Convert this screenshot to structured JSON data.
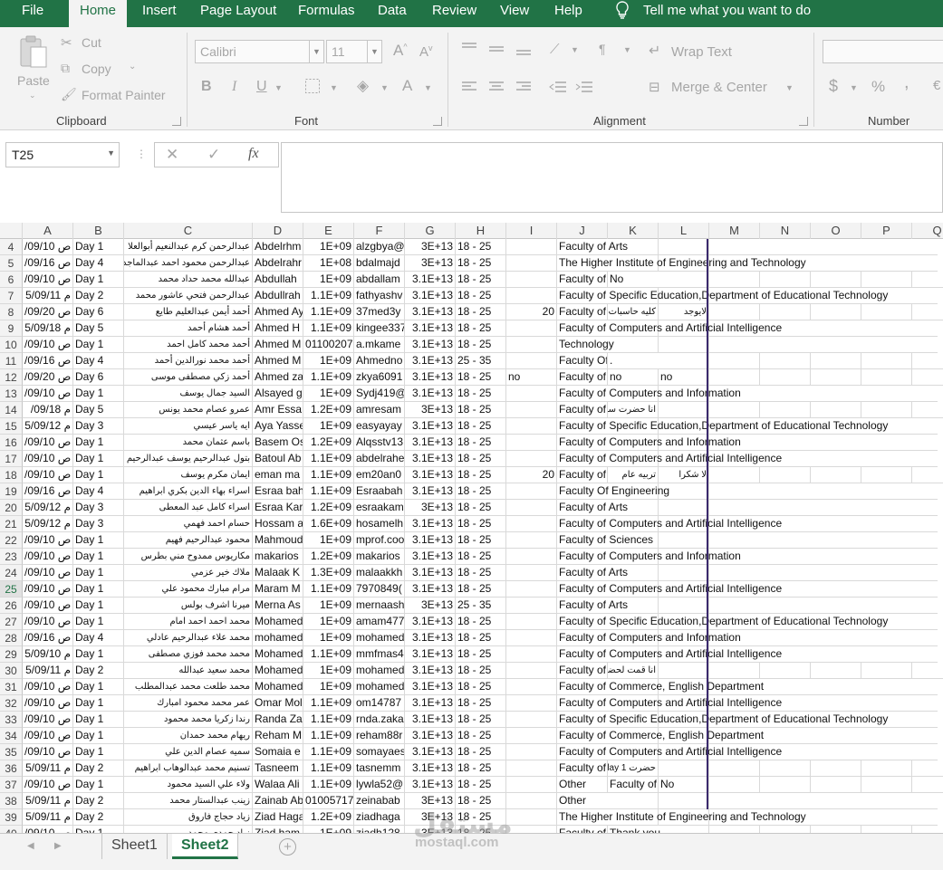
{
  "menu": {
    "file": "File",
    "home": "Home",
    "insert": "Insert",
    "page_layout": "Page Layout",
    "formulas": "Formulas",
    "data": "Data",
    "review": "Review",
    "view": "View",
    "help": "Help",
    "tell_me": "Tell me what you want to do"
  },
  "ribbon": {
    "clipboard": {
      "paste": "Paste",
      "cut": "Cut",
      "copy": "Copy",
      "format_painter": "Format Painter",
      "label": "Clipboard"
    },
    "font": {
      "name": "Calibri",
      "size": "11",
      "label": "Font",
      "bold": "B",
      "italic": "I",
      "underline": "U",
      "grow": "A",
      "shrink": "A",
      "font_color": "A"
    },
    "alignment": {
      "wrap_text": "Wrap Text",
      "merge_center": "Merge & Center",
      "label": "Alignment"
    },
    "number": {
      "label": "Number",
      "currency": "$",
      "percent": "%",
      "comma": ","
    }
  },
  "formula_bar": {
    "name_box": "T25",
    "cancel": "✕",
    "enter": "✓",
    "fx": "fx",
    "value": ""
  },
  "columns": [
    "A",
    "B",
    "C",
    "D",
    "E",
    "F",
    "G",
    "H",
    "I",
    "J",
    "K",
    "L",
    "M",
    "N",
    "O",
    "P",
    "Q"
  ],
  "rows": [
    {
      "n": "4",
      "a": "/09/10 ص",
      "b": "Day 1",
      "c": "عبدالرحمن كرم عبدالنعيم أبوالعلا",
      "d": "Abdelrhm",
      "e": "1E+09",
      "f": "alzgbya@",
      "g": "3E+13",
      "h": "18 - 25",
      "i": "",
      "j": "Faculty of Arts",
      "k": "",
      "l": ""
    },
    {
      "n": "5",
      "a": "/09/16 ص",
      "b": "Day 4",
      "c": "عبدالرحمن محمود احمد عبدالماجد",
      "d": "Abdelrahr",
      "e": "1E+08",
      "f": "bdalmajd",
      "g": "3E+13",
      "h": "18 - 25",
      "i": "",
      "j": "The Higher Institute of Engineering and Technology",
      "k": "",
      "l": ""
    },
    {
      "n": "6",
      "a": "/09/10 ص",
      "b": "Day 1",
      "c": "عبدالله محمد حداد محمد",
      "d": "Abdullah",
      "e": "1E+09",
      "f": "abdallam",
      "g": "3.1E+13",
      "h": "18 - 25",
      "i": "",
      "j": "Faculty of Compute",
      "k": "No",
      "l": ""
    },
    {
      "n": "7",
      "a": "5/09/11 م",
      "b": "Day 2",
      "c": "عبدالرحمن فتحي عاشور محمد",
      "d": "Abdullrah",
      "e": "1.1E+09",
      "f": "fathyashv",
      "g": "3.1E+13",
      "h": "18 - 25",
      "i": "",
      "j": "Faculty of Specific Education,Department of Educational Technology",
      "k": "",
      "l": ""
    },
    {
      "n": "8",
      "a": "/09/20 ص",
      "b": "Day 6",
      "c": "أحمد أيمن عبدالعليم طايع",
      "d": "Ahmed Ay",
      "e": "1.1E+09",
      "f": "37med3y",
      "g": "3.1E+13",
      "h": "18 - 25",
      "i": "20",
      "j": "Faculty of",
      "k": "كليه حاسبات و",
      "l": "لايوجد"
    },
    {
      "n": "9",
      "a": "5/09/18 م",
      "b": "Day 5",
      "c": "أحمد هشام أحمد",
      "d": "Ahmed H",
      "e": "1.1E+09",
      "f": "kingee337",
      "g": "3.1E+13",
      "h": "18 - 25",
      "i": "",
      "j": "Faculty of Computers and Artificial Intelligence",
      "k": "",
      "l": ""
    },
    {
      "n": "10",
      "a": "/09/10 ص",
      "b": "Day 1",
      "c": "أحمد محمد كامل احمد",
      "d": "Ahmed M",
      "e": "01100207",
      "f": "a.mkame",
      "g": "3.1E+13",
      "h": "18 - 25",
      "i": "",
      "j": "Technology",
      "k": "",
      "l": ""
    },
    {
      "n": "11",
      "a": "/09/16 ص",
      "b": "Day 4",
      "c": "أحمد محمد نورالدين أحمد",
      "d": "Ahmed M",
      "e": "1E+09",
      "f": "Ahmedno",
      "g": "3.1E+13",
      "h": "25 - 35",
      "i": "",
      "j": "Faculty Of Engineeri",
      "k": ".",
      "l": ""
    },
    {
      "n": "12",
      "a": "/09/20 ص",
      "b": "Day 6",
      "c": "أحمد زكي مصطفى موسى",
      "d": "Ahmed za",
      "e": "1.1E+09",
      "f": "zkya6091",
      "g": "3.1E+13",
      "h": "18 - 25",
      "i": "no",
      "j": "Faculty of",
      "k": "no",
      "l": "no"
    },
    {
      "n": "13",
      "a": "/09/10 ص",
      "b": "Day 1",
      "c": "السيد جمال يوسف",
      "d": "Alsayed g",
      "e": "1E+09",
      "f": "Sydj419@",
      "g": "3.1E+13",
      "h": "18 - 25",
      "i": "",
      "j": "Faculty of Computers and Information",
      "k": "",
      "l": ""
    },
    {
      "n": "14",
      "a": "/09/18 م",
      "b": "Day 5",
      "c": "عمرو عصام محمد يونس",
      "d": "Amr Essa",
      "e": "1.2E+09",
      "f": "amresam",
      "g": "3E+13",
      "h": "18 - 25",
      "i": "",
      "j": "Faculty of Computer",
      "k": "انا حضرت سيشن",
      "l": ""
    },
    {
      "n": "15",
      "a": "5/09/12 م",
      "b": "Day 3",
      "c": "ايه ياسر عيسي",
      "d": "Aya Yasse",
      "e": "1E+09",
      "f": "easyayay",
      "g": "3.1E+13",
      "h": "18 - 25",
      "i": "",
      "j": "Faculty of Specific Education,Department of Educational Technology",
      "k": "",
      "l": ""
    },
    {
      "n": "16",
      "a": "/09/10 ص",
      "b": "Day 1",
      "c": "باسم عثمان محمد",
      "d": "Basem Os",
      "e": "1.2E+09",
      "f": "Alqsstv13",
      "g": "3.1E+13",
      "h": "18 - 25",
      "i": "",
      "j": "Faculty of Computers and Information",
      "k": "",
      "l": ""
    },
    {
      "n": "17",
      "a": "/09/10 ص",
      "b": "Day 1",
      "c": "بتول عبدالرحيم يوسف عبدالرحيم",
      "d": "Batoul Ab",
      "e": "1.1E+09",
      "f": "abdelrahe",
      "g": "3.1E+13",
      "h": "18 - 25",
      "i": "",
      "j": "Faculty of Computers and Artificial Intelligence",
      "k": "",
      "l": ""
    },
    {
      "n": "18",
      "a": "/09/10 ص",
      "b": "Day 1",
      "c": "ايمان مكرم يوسف",
      "d": "eman ma",
      "e": "1.1E+09",
      "f": "em20an0",
      "g": "3.1E+13",
      "h": "18 - 25",
      "i": "20",
      "j": "Faculty of",
      "k": "تربيه عام",
      "l": "لا شكرا"
    },
    {
      "n": "19",
      "a": "/09/16 ص",
      "b": "Day 4",
      "c": "اسراء بهاء الدين بكري ابراهيم",
      "d": "Esraa bah",
      "e": "1.1E+09",
      "f": "Esraabah",
      "g": "3.1E+13",
      "h": "18 - 25",
      "i": "",
      "j": "Faculty Of Engineering",
      "k": "",
      "l": ""
    },
    {
      "n": "20",
      "a": "5/09/12 م",
      "b": "Day 3",
      "c": "اسراء كامل عبد المعطى",
      "d": "Esraa Kar",
      "e": "1.2E+09",
      "f": "esraakam",
      "g": "3E+13",
      "h": "18 - 25",
      "i": "",
      "j": "Faculty of Arts",
      "k": "",
      "l": ""
    },
    {
      "n": "21",
      "a": "5/09/12 م",
      "b": "Day 3",
      "c": "حسام احمد فهمي",
      "d": "Hossam a",
      "e": "1.6E+09",
      "f": "hosamelh",
      "g": "3.1E+13",
      "h": "18 - 25",
      "i": "",
      "j": "Faculty of Computers and Artificial Intelligence",
      "k": "",
      "l": ""
    },
    {
      "n": "22",
      "a": "/09/10 ص",
      "b": "Day 1",
      "c": "محمود عبدالرحيم فهيم",
      "d": "Mahmoud",
      "e": "1E+09",
      "f": "mprof.coo",
      "g": "3.1E+13",
      "h": "18 - 25",
      "i": "",
      "j": "Faculty of Sciences",
      "k": "",
      "l": ""
    },
    {
      "n": "23",
      "a": "/09/10 ص",
      "b": "Day 1",
      "c": "مكاريوس ممدوح مني بطرس",
      "d": "makarios",
      "e": "1.2E+09",
      "f": "makarios",
      "g": "3.1E+13",
      "h": "18 - 25",
      "i": "",
      "j": "Faculty of Computers and Information",
      "k": "",
      "l": ""
    },
    {
      "n": "24",
      "a": "/09/10 ص",
      "b": "Day 1",
      "c": "ملاك خير عزمي",
      "d": "Malaak K",
      "e": "1.3E+09",
      "f": "malaakkh",
      "g": "3.1E+13",
      "h": "18 - 25",
      "i": "",
      "j": "Faculty of Arts",
      "k": "",
      "l": ""
    },
    {
      "n": "25",
      "a": "/09/10 ص",
      "b": "Day 1",
      "c": "مرام مبارك محمود علي",
      "d": "Maram M",
      "e": "1.1E+09",
      "f": "7970849(",
      "g": "3.1E+13",
      "h": "18 - 25",
      "i": "",
      "j": "Faculty of Computers and Artificial Intelligence",
      "k": "",
      "l": "",
      "sel": true
    },
    {
      "n": "26",
      "a": "/09/10 ص",
      "b": "Day 1",
      "c": "ميرنا اشرف بولس",
      "d": "Merna As",
      "e": "1E+09",
      "f": "mernaash",
      "g": "3E+13",
      "h": "25 - 35",
      "i": "",
      "j": "Faculty of Arts",
      "k": "",
      "l": ""
    },
    {
      "n": "27",
      "a": "/09/10 ص",
      "b": "Day 1",
      "c": "محمد احمد احمد امام",
      "d": "Mohamed",
      "e": "1E+09",
      "f": "amam477",
      "g": "3.1E+13",
      "h": "18 - 25",
      "i": "",
      "j": "Faculty of Specific Education,Department of Educational Technology",
      "k": "",
      "l": ""
    },
    {
      "n": "28",
      "a": "/09/16 ص",
      "b": "Day 4",
      "c": "محمد علاء عبدالرحيم عادلي",
      "d": "mohamed",
      "e": "1E+09",
      "f": "mohamed",
      "g": "3.1E+13",
      "h": "18 - 25",
      "i": "",
      "j": "Faculty of Computers and Information",
      "k": "",
      "l": ""
    },
    {
      "n": "29",
      "a": "5/09/10 م",
      "b": "Day 1",
      "c": "محمد محمد فوزي مصطفى",
      "d": "Mohamed",
      "e": "1.1E+09",
      "f": "mmfmas4",
      "g": "3.1E+13",
      "h": "18 - 25",
      "i": "",
      "j": "Faculty of Computers and Artificial Intelligence",
      "k": "",
      "l": ""
    },
    {
      "n": "30",
      "a": "5/09/11 م",
      "b": "Day 2",
      "c": "محمد سعيد عبدالله",
      "d": "Mohamed",
      "e": "1E+09",
      "f": "mohamed",
      "g": "3.1E+13",
      "h": "18 - 25",
      "i": "",
      "j": "Faculty of Computer",
      "k": "انا قمت لحضرتك",
      "l": ""
    },
    {
      "n": "31",
      "a": "/09/10 ص",
      "b": "Day 1",
      "c": "محمد طلعت محمد عبدالمطلب",
      "d": "Mohamed",
      "e": "1E+09",
      "f": "mohamed",
      "g": "3.1E+13",
      "h": "18 - 25",
      "i": "",
      "j": "Faculty of Commerce, English Department",
      "k": "",
      "l": ""
    },
    {
      "n": "32",
      "a": "/09/10 ص",
      "b": "Day 1",
      "c": "عمر محمد محمود امبارك",
      "d": "Omar Mol",
      "e": "1.1E+09",
      "f": "om14787",
      "g": "3.1E+13",
      "h": "18 - 25",
      "i": "",
      "j": "Faculty of Computers and Artificial Intelligence",
      "k": "",
      "l": ""
    },
    {
      "n": "33",
      "a": "/09/10 ص",
      "b": "Day 1",
      "c": "رندا زكريا محمد محمود",
      "d": "Randa Za",
      "e": "1.1E+09",
      "f": "rnda.zaka",
      "g": "3.1E+13",
      "h": "18 - 25",
      "i": "",
      "j": "Faculty of Specific Education,Department of Educational Technology",
      "k": "",
      "l": ""
    },
    {
      "n": "34",
      "a": "/09/10 ص",
      "b": "Day 1",
      "c": "ريهام محمد حمدان",
      "d": "Reham M",
      "e": "1.1E+09",
      "f": "reham88r",
      "g": "3.1E+13",
      "h": "18 - 25",
      "i": "",
      "j": "Faculty of Commerce, English Department",
      "k": "",
      "l": ""
    },
    {
      "n": "35",
      "a": "/09/10 ص",
      "b": "Day 1",
      "c": "سميه عصام الدين علي",
      "d": "Somaia e",
      "e": "1.1E+09",
      "f": "somayaes",
      "g": "3.1E+13",
      "h": "18 - 25",
      "i": "",
      "j": "Faculty of Computers and Artificial Intelligence",
      "k": "",
      "l": ""
    },
    {
      "n": "36",
      "a": "5/09/11 م",
      "b": "Day 2",
      "c": "تسنيم محمد عبدالوهاب ابراهيم",
      "d": "Tasneem",
      "e": "1.1E+09",
      "f": "tasnemm",
      "g": "3.1E+13",
      "h": "18 - 25",
      "i": "",
      "j": "Faculty of Computer",
      "k": "حضرت day 1",
      "l": ""
    },
    {
      "n": "37",
      "a": "/09/10 ص",
      "b": "Day 1",
      "c": "ولاء علي السيد محمود",
      "d": "Walaa Ali",
      "e": "1.1E+09",
      "f": "lywla52@",
      "g": "3.1E+13",
      "h": "18 - 25",
      "i": "",
      "j": "Other",
      "k": "Faculty of",
      "l": "No"
    },
    {
      "n": "38",
      "a": "5/09/11 م",
      "b": "Day 2",
      "c": "زينب عبدالستار محمد",
      "d": "Zainab Ab",
      "e": "01005717",
      "f": "zeinabab",
      "g": "3E+13",
      "h": "18 - 25",
      "i": "",
      "j": "Other",
      "k": "",
      "l": ""
    },
    {
      "n": "39",
      "a": "5/09/11 م",
      "b": "Day 2",
      "c": "زياد حجاج فاروق",
      "d": "Ziad Haga",
      "e": "1.2E+09",
      "f": "ziadhaga",
      "g": "3E+13",
      "h": "18 - 25",
      "i": "",
      "j": "The Higher Institute of Engineering and Technology",
      "k": "",
      "l": ""
    },
    {
      "n": "40",
      "a": "/09/10 ص",
      "b": "Day 1",
      "c": "زياد حمدي محمد",
      "d": "Ziad ham",
      "e": "1E+09",
      "f": "ziadh128",
      "g": "3E+13",
      "h": "18 - 25",
      "i": "",
      "j": "Faculty of Compute",
      "k": "Thank you",
      "l": ""
    }
  ],
  "sheets": [
    "Sheet1",
    "Sheet2"
  ],
  "active_sheet": "Sheet2",
  "watermark": {
    "main": "مستقل",
    "sub": "mostaql.com"
  },
  "colors": {
    "excel_green": "#217346",
    "ribbon_bg": "#f3f3f3"
  }
}
